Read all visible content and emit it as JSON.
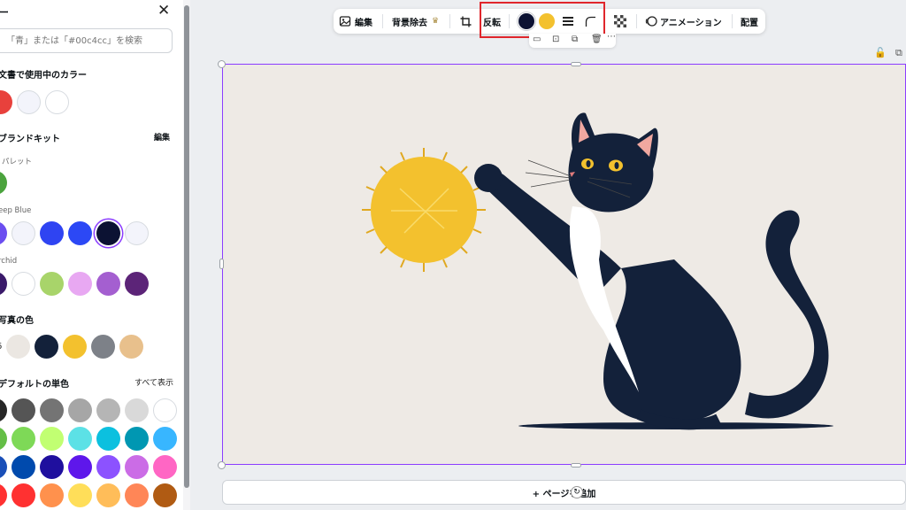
{
  "panel": {
    "title": "ー",
    "search_placeholder": "「青」または「#00c4cc」を検索",
    "doc_colors": {
      "title": "文書で使用中のカラー",
      "colors": [
        "#e8413c",
        "#f3f4fb",
        "#ffffff"
      ]
    },
    "brand_kit": {
      "title": "ブランドキット",
      "edit_label": "編集",
      "palettes": [
        {
          "name": "パレット",
          "colors": [
            "#4ba33d"
          ]
        },
        {
          "name": "eep Blue",
          "colors": [
            "#6b4ef0",
            "#f3f4fb",
            "#2f44f2",
            "#2c48f5",
            "#0c1233",
            "#f3f4fb"
          ],
          "selected_index": 4
        },
        {
          "name": "rchid",
          "colors": [
            "#3a1a6a",
            "#ffffff",
            "#a8d46a",
            "#e8a8f2",
            "#a45fd0",
            "#5c2478"
          ]
        }
      ]
    },
    "photo_colors": {
      "title": "写真の色",
      "prefix": "6",
      "colors": [
        "#ebe7e2",
        "#13213a",
        "#f3c12e",
        "#7d8188",
        "#e8c08c"
      ]
    },
    "default_colors": {
      "title": "デフォルトの単色",
      "show_all": "すべて表示",
      "rows": [
        [
          "#262626",
          "#555555",
          "#747474",
          "#a6a6a6",
          "#b5b5b5",
          "#d9d9d9",
          "#ffffff"
        ],
        [
          "#64be46",
          "#7ed957",
          "#c1ff72",
          "#5ce1e6",
          "#0cc0df",
          "#0097b2",
          "#38b6ff"
        ],
        [
          "#1a4fb8",
          "#004aad",
          "#1f0f9e",
          "#5e17eb",
          "#8c52ff",
          "#cb6ce6",
          "#ff66c4"
        ],
        [
          "#ff3131",
          "#ff3131",
          "#ff914d",
          "#ffde59",
          "#ffbd59",
          "#ff8657",
          "#b05b13"
        ]
      ]
    }
  },
  "toolbar": {
    "edit": "編集",
    "bg_remove": "背景除去",
    "flip": "反転",
    "color1": "#0c1233",
    "color2": "#f3c12e",
    "animation": "アニメーション",
    "position": "配置"
  },
  "add_page": "+ ページを追加",
  "icons": {
    "edit": "image-edit-icon",
    "crown": "crown-icon",
    "crop": "crop-icon",
    "lines": "border-style-icon",
    "corner": "corner-rounding-icon",
    "transparency": "transparency-icon",
    "animation": "animation-icon",
    "lock": "lock-icon",
    "duplicate": "duplicate-icon"
  },
  "colors": {
    "accent": "#8b3dff",
    "highlight": "#e0262c"
  }
}
